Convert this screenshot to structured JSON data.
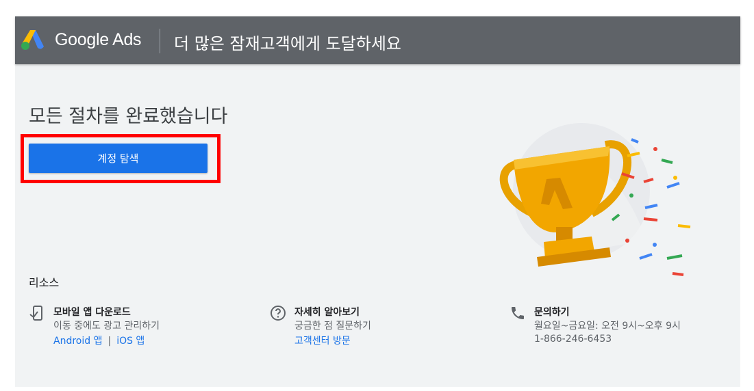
{
  "header": {
    "brand": "Google Ads",
    "tagline": "더 많은 잠재고객에게 도달하세요"
  },
  "main": {
    "heading": "모든 절차를 완료했습니다",
    "primary_button": "계정 탐색"
  },
  "resources": {
    "title": "리소스",
    "items": [
      {
        "icon": "mobile-download-icon",
        "title": "모바일 앱 다운로드",
        "description": "이동 중에도 광고 관리하기",
        "links": [
          "Android 앱",
          "iOS 앱"
        ],
        "separator": "|"
      },
      {
        "icon": "help-circle-icon",
        "title": "자세히 알아보기",
        "description": "궁금한 점 질문하기",
        "links": [
          "고객센터 방문"
        ]
      },
      {
        "icon": "phone-icon",
        "title": "문의하기",
        "description": "월요일~금요일: 오전 9시~오후 9시",
        "phone": "1-866-246-6453"
      }
    ]
  },
  "colors": {
    "header_bg": "#5f6368",
    "page_bg": "#f1f3f4",
    "primary": "#1a73e8",
    "highlight": "#ff0000",
    "trophy_gold": "#f2a600"
  }
}
